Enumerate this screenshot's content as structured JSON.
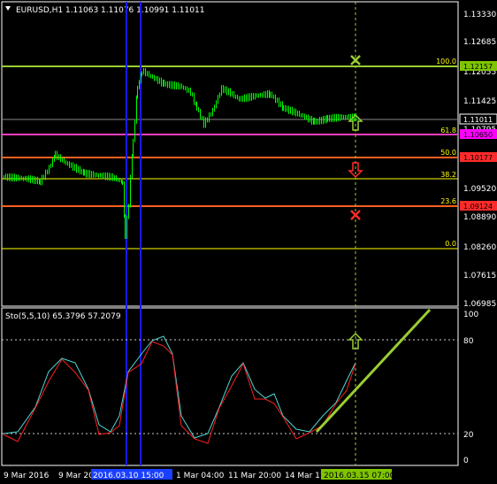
{
  "chart": {
    "symbol_header": "EURUSD,H1  1.11063 1.11076 1.10991 1.11011",
    "indicator_header": "Sto(5,5,10) 65.3796 57.2079"
  },
  "price_axis": [
    "1.13330",
    "1.12685",
    "1.12055",
    "1.11425",
    "1.10795",
    "1.10165",
    "1.09520",
    "1.08890",
    "1.08260",
    "1.07615",
    "1.06985"
  ],
  "price_tags": [
    {
      "label": "1.12157",
      "bg": "#7fc400",
      "fg": "#000000"
    },
    {
      "label": "1.11011",
      "bg": "#000000",
      "fg": "#ffffff"
    },
    {
      "label": "1.10650",
      "bg": "#ff00ff",
      "fg": "#000000"
    },
    {
      "label": "1.10177",
      "bg": "#ff2a2a",
      "fg": "#000000"
    },
    {
      "label": "1.09124",
      "bg": "#ff2a2a",
      "fg": "#000000"
    }
  ],
  "fib_levels": [
    "100.0",
    "61.8",
    "50.0",
    "38.2",
    "23.6",
    "0.0"
  ],
  "osc_axis": [
    "100",
    "80",
    "20",
    "0"
  ],
  "time_axis": [
    "9 Mar 2016",
    "9 Mar 20",
    "2016.03.10 15:00",
    "1 Mar 04:00",
    "11 Mar 20:00",
    "14 Mar 11",
    "2016.03.15 07:00"
  ],
  "colors": {
    "candle": "#00ff00",
    "fib": "#ffff00",
    "level_green": "#9acd32",
    "level_red": "#ff2a2a",
    "level_magenta": "#ff00ff",
    "vline": "#1a1aff",
    "stoch_main": "#4fd6d6",
    "stoch_signal": "#ff2020"
  },
  "icons": [
    "up-arrow-icon",
    "down-arrow-icon",
    "cross-icon",
    "dropdown-icon"
  ]
}
